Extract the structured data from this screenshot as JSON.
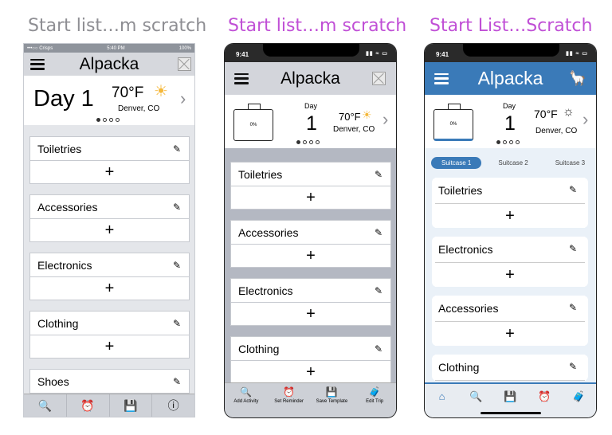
{
  "panels": [
    {
      "title": "Start list…m scratch"
    },
    {
      "title": "Start list…m scratch"
    },
    {
      "title": "Start List…Scratch"
    }
  ],
  "s1": {
    "status": {
      "carrier": "•••○○ Crisps ",
      "time": "5:40 PM",
      "battery": "100%"
    },
    "app_title": "Alpacka",
    "trip": {
      "day": "Day 1",
      "temp": "70°F",
      "location": "Denver, CO"
    },
    "categories": [
      "Toiletries",
      "Accessories",
      "Electronics",
      "Clothing",
      "Shoes"
    ],
    "plus": "+",
    "bottom_icons": [
      "search-activity",
      "alarm",
      "save",
      "info"
    ]
  },
  "s2": {
    "status": {
      "time": "9:41"
    },
    "app_title": "Alpacka",
    "trip": {
      "day_label": "Day",
      "day_num": "1",
      "temp": "70°F",
      "location": "Denver, CO",
      "progress": "0%"
    },
    "categories": [
      "Toiletries",
      "Accessories",
      "Electronics",
      "Clothing"
    ],
    "plus": "+",
    "bottom": [
      {
        "label": "Add Activity",
        "icon": "search-activity"
      },
      {
        "label": "Set Reminder",
        "icon": "alarm"
      },
      {
        "label": "Save Template",
        "icon": "save"
      },
      {
        "label": "Edit Trip",
        "icon": "luggage-edit"
      }
    ]
  },
  "s3": {
    "status": {
      "time": "9:41"
    },
    "app_title": "Alpacka",
    "trip": {
      "day_label": "Day",
      "day_num": "1",
      "temp": "70°F",
      "location": "Denver, CO",
      "progress": "0%"
    },
    "tabs": [
      "Suitcase 1",
      "Suitcase 2",
      "Suitcase 3"
    ],
    "active_tab": "Suitcase 1",
    "categories": [
      "Toiletries",
      "Electronics",
      "Accessories",
      "Clothing"
    ],
    "plus": "+",
    "bottom_icons": [
      "home",
      "search-activity",
      "save",
      "alarm",
      "luggage-edit"
    ]
  },
  "colors": {
    "accent_blue": "#3a7ab8",
    "title_purple": "#c04fd6",
    "title_gray": "#8e8e93"
  }
}
